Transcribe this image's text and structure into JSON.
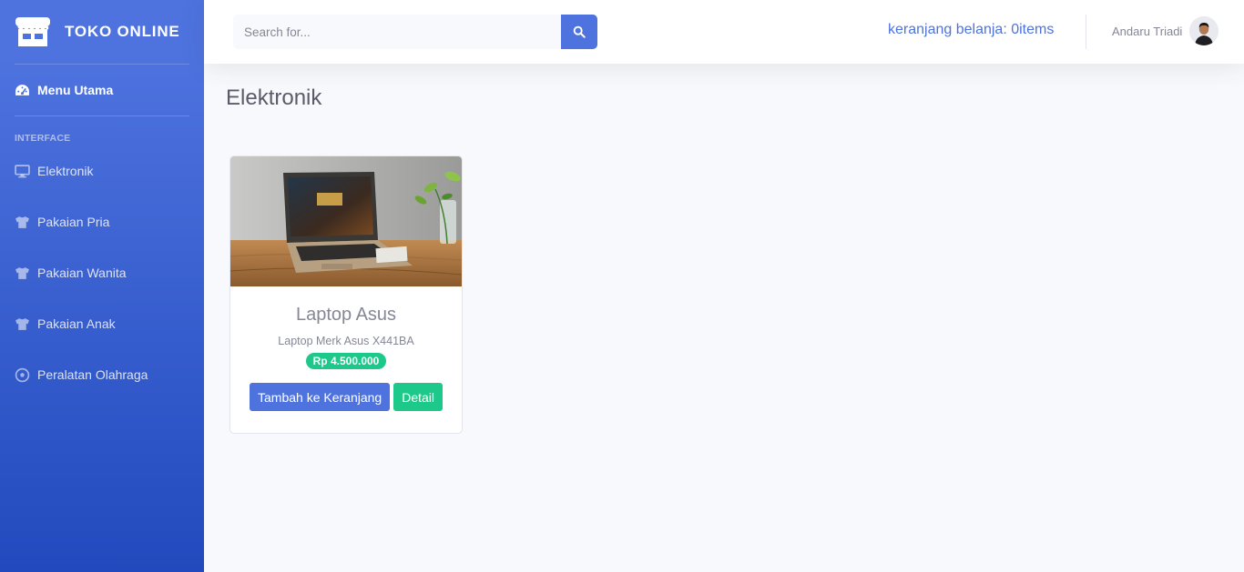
{
  "brand": {
    "name": "TOKO ONLINE",
    "icon": "store-icon"
  },
  "sidebar": {
    "main_item": {
      "label": "Menu Utama",
      "icon": "dashboard-icon"
    },
    "heading": "INTERFACE",
    "items": [
      {
        "label": "Elektronik",
        "icon": "desktop-icon"
      },
      {
        "label": "Pakaian Pria",
        "icon": "tshirt-icon"
      },
      {
        "label": "Pakaian Wanita",
        "icon": "tshirt-icon"
      },
      {
        "label": "Pakaian Anak",
        "icon": "tshirt-icon"
      },
      {
        "label": "Peralatan Olahraga",
        "icon": "futbol-icon"
      }
    ]
  },
  "topbar": {
    "search_placeholder": "Search for...",
    "search_icon": "search-icon",
    "cart_text": "keranjang belanja: 0items",
    "user_name": "Andaru Triadi"
  },
  "page": {
    "title": "Elektronik"
  },
  "products": [
    {
      "name": "Laptop Asus",
      "description": "Laptop Merk Asus X441BA",
      "price": "Rp 4.500.000",
      "add_button": "Tambah ke Keranjang",
      "detail_button": "Detail"
    }
  ],
  "colors": {
    "primary": "#4e73df",
    "success": "#1cc88a",
    "sidebar_bottom": "#224abe"
  }
}
